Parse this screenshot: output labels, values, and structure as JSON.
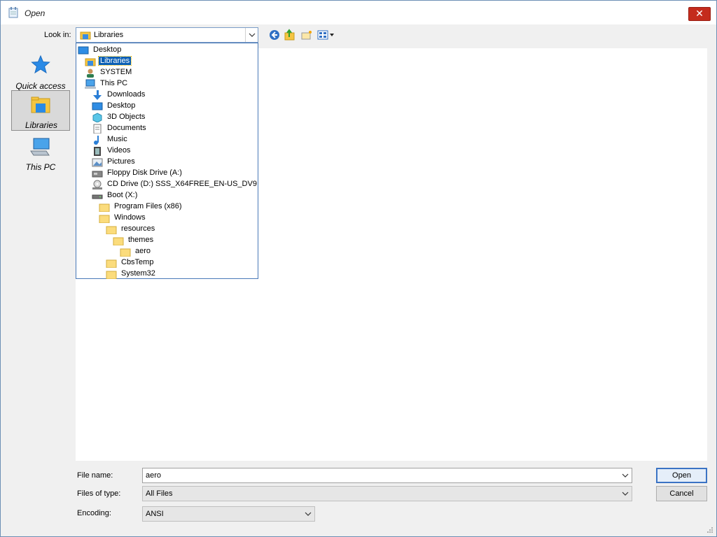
{
  "window": {
    "title": "Open",
    "close_glyph": "✕"
  },
  "lookin": {
    "label": "Look in:",
    "value": "Libraries"
  },
  "toolbar": {
    "back_icon": "back-arrow-icon",
    "up_icon": "up-folder-icon",
    "newfolder_icon": "new-folder-icon",
    "view_icon": "view-menu-icon"
  },
  "places": [
    {
      "label": "Quick access",
      "icon": "star-icon"
    },
    {
      "label": "Libraries",
      "icon": "library-icon",
      "selected": true
    },
    {
      "label": "This PC",
      "icon": "computer-icon"
    }
  ],
  "dropdown": [
    {
      "label": "Desktop",
      "icon": "desktop-icon",
      "indent": 0
    },
    {
      "label": "Libraries",
      "icon": "library-icon",
      "indent": 1,
      "selected": true
    },
    {
      "label": "SYSTEM",
      "icon": "user-icon",
      "indent": 1
    },
    {
      "label": "This PC",
      "icon": "computer-icon",
      "indent": 1
    },
    {
      "label": "Downloads",
      "icon": "download-icon",
      "indent": 2
    },
    {
      "label": "Desktop",
      "icon": "desktop-icon",
      "indent": 2
    },
    {
      "label": "3D Objects",
      "icon": "cube-icon",
      "indent": 2
    },
    {
      "label": "Documents",
      "icon": "document-icon",
      "indent": 2
    },
    {
      "label": "Music",
      "icon": "music-icon",
      "indent": 2
    },
    {
      "label": "Videos",
      "icon": "video-icon",
      "indent": 2
    },
    {
      "label": "Pictures",
      "icon": "picture-icon",
      "indent": 2
    },
    {
      "label": "Floppy Disk Drive (A:)",
      "icon": "floppy-icon",
      "indent": 2
    },
    {
      "label": "CD Drive (D:) SSS_X64FREE_EN-US_DV9",
      "icon": "cd-icon",
      "indent": 2
    },
    {
      "label": "Boot (X:)",
      "icon": "drive-icon",
      "indent": 2
    },
    {
      "label": "Program Files (x86)",
      "icon": "folder-icon",
      "indent": 3
    },
    {
      "label": "Windows",
      "icon": "folder-icon",
      "indent": 3
    },
    {
      "label": "resources",
      "icon": "folder-icon",
      "indent": 4
    },
    {
      "label": "themes",
      "icon": "folder-icon",
      "indent": 5
    },
    {
      "label": "aero",
      "icon": "folder-icon",
      "indent": 6
    },
    {
      "label": "CbsTemp",
      "icon": "folder-icon",
      "indent": 4
    },
    {
      "label": "System32",
      "icon": "folder-icon",
      "indent": 4
    }
  ],
  "form": {
    "filename_label": "File name:",
    "filename_value": "aero",
    "filetype_label": "Files of type:",
    "filetype_value": "All Files",
    "encoding_label": "Encoding:",
    "encoding_value": "ANSI"
  },
  "buttons": {
    "open": "Open",
    "cancel": "Cancel"
  },
  "colors": {
    "selection": "#0a5fb5",
    "close": "#c42b1c",
    "border_accent": "#4a7ab8"
  }
}
